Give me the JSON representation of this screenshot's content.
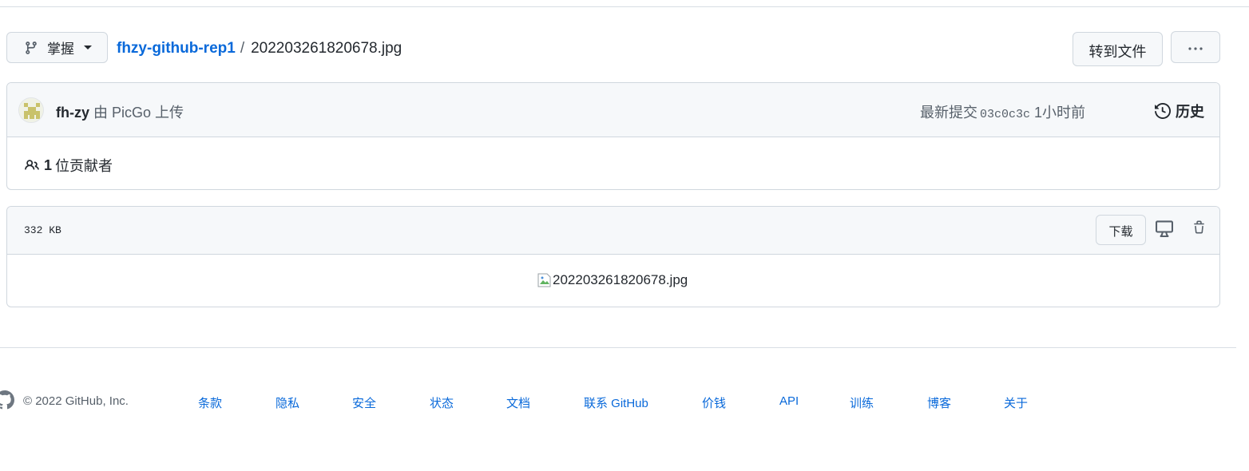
{
  "header": {
    "branch_label": "掌握",
    "repo_name": "fhzy-github-rep1",
    "separator": "/",
    "file_name": "202203261820678.jpg",
    "goto_file_label": "转到文件",
    "more_label": "···"
  },
  "commit": {
    "author": "fh-zy",
    "message": "由 PicGo 上传",
    "latest_commit_label": "最新提交",
    "sha": "03c0c3c",
    "time_ago": "1小时前",
    "history_label": "历史",
    "contributors_count": "1",
    "contributors_label": "位贡献者"
  },
  "file": {
    "size": "332 KB",
    "download_label": "下载",
    "image_alt": "202203261820678.jpg"
  },
  "footer": {
    "copyright": "© 2022 GitHub, Inc.",
    "links": [
      "条款",
      "隐私",
      "安全",
      "状态",
      "文档",
      "联系 GitHub",
      "价钱",
      "API",
      "训练",
      "博客",
      "关于"
    ]
  },
  "icons": {
    "branch": "git-branch-icon",
    "more": "kebab-horizontal-icon",
    "history": "history-icon",
    "people": "people-icon",
    "display": "device-desktop-icon",
    "trash": "trash-icon",
    "broken_image": "broken-image-icon",
    "logo": "github-mark-icon"
  },
  "colors": {
    "link": "#0969da",
    "text": "#24292f",
    "muted": "#57606a",
    "border": "#d0d7de",
    "header_bg": "#f6f8fa"
  }
}
